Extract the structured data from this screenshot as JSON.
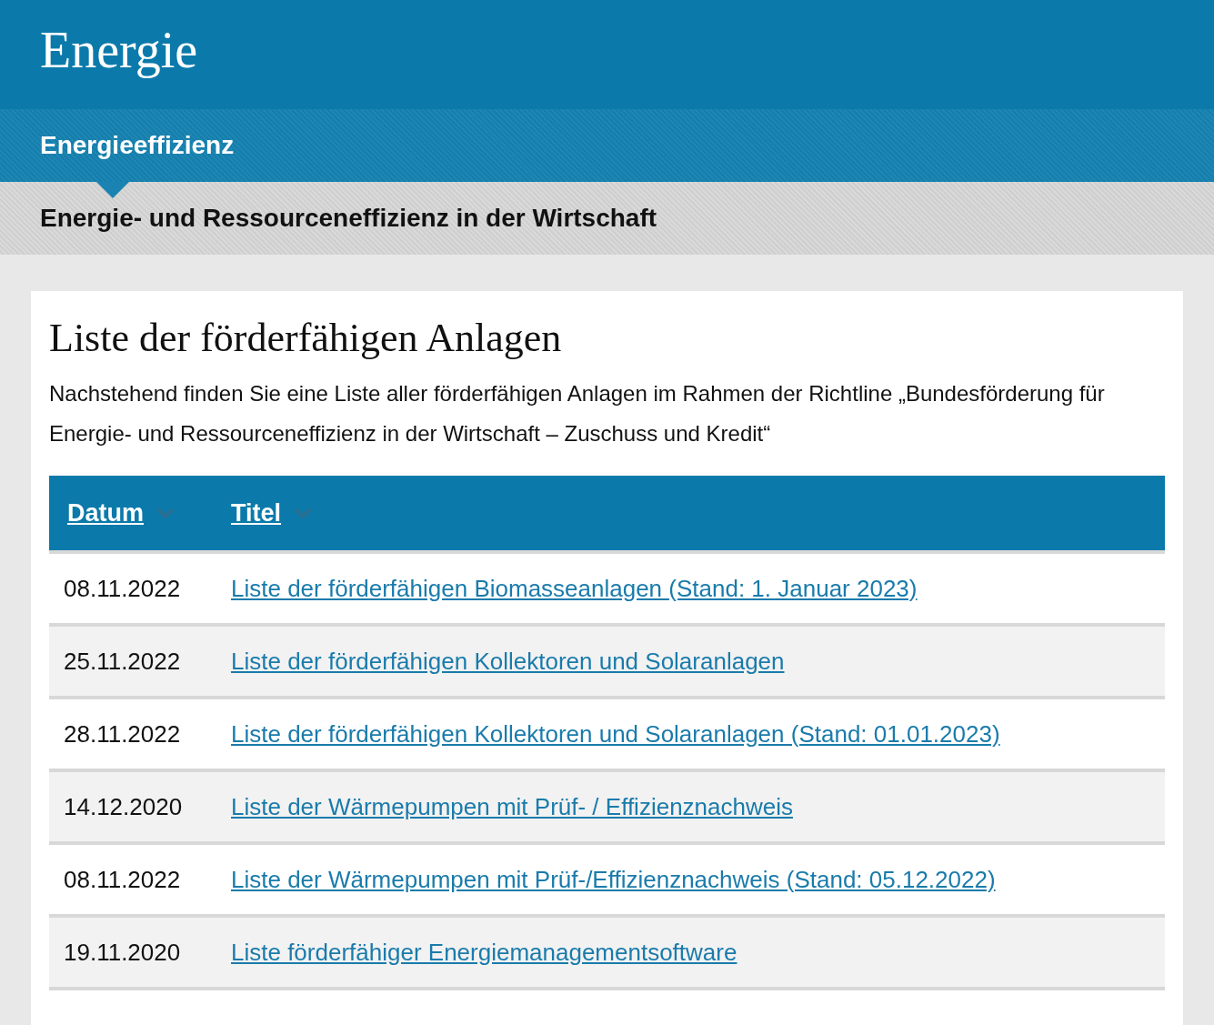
{
  "header": {
    "title": "Energie"
  },
  "breadcrumb": [
    {
      "label": "Energieeffizienz",
      "kind": "section"
    },
    {
      "label": "Energie- und Ressourceneffizienz in der Wirtschaft",
      "kind": "page"
    }
  ],
  "content": {
    "title": "Liste der förderfähigen Anlagen",
    "intro": "Nachstehend finden Sie eine Liste aller förderfähigen Anlagen im Rahmen der Richtline „Bundesförderung für Energie- und Ressourceneffizienz in der Wirtschaft – Zuschuss und Kredit“"
  },
  "table": {
    "columns": [
      "Datum",
      "Titel"
    ],
    "rows": [
      {
        "date": "08.11.2022",
        "title": "Liste der förderfähigen Biomasseanlagen (Stand: 1. Januar 2023)"
      },
      {
        "date": "25.11.2022",
        "title": "Liste der förderfähigen Kollektoren und Solaranlagen"
      },
      {
        "date": "28.11.2022",
        "title": "Liste der förderfähigen Kollektoren und Solaranlagen (Stand: 01.01.2023)"
      },
      {
        "date": "14.12.2020",
        "title": "Liste der Wärmepumpen mit Prüf- / Effizienznachweis"
      },
      {
        "date": "08.11.2022",
        "title": "Liste der Wärmepumpen mit Prüf-/Effizienznachweis (Stand: 05.12.2022)"
      },
      {
        "date": "19.11.2020",
        "title": "Liste förderfähiger Energiemanagementsoftware"
      }
    ]
  }
}
